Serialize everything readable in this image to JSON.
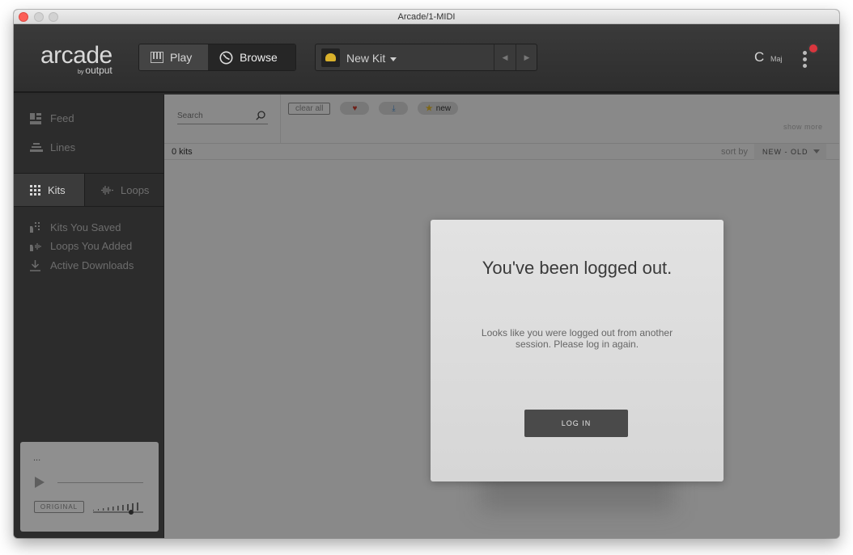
{
  "window": {
    "title": "Arcade/1-MIDI"
  },
  "header": {
    "logo": "arcade",
    "logo_by": "by",
    "logo_sub": "output",
    "mode_play": "Play",
    "mode_browse": "Browse",
    "kit_name": "New Kit",
    "key_root": "C",
    "key_mode": "Maj"
  },
  "sidebar": {
    "feed": "Feed",
    "lines": "Lines",
    "tab_kits": "Kits",
    "tab_loops": "Loops",
    "saved": "Kits You Saved",
    "added": "Loops You Added",
    "downloads": "Active Downloads"
  },
  "player": {
    "title": "...",
    "original_label": "ORIGINAL"
  },
  "main": {
    "search_placeholder": "Search",
    "clear_all": "clear all",
    "filter_new": "new",
    "show_more": "show more",
    "kits_count": "0 kits",
    "sort_label": "sort by",
    "sort_value": "NEW - OLD",
    "empty_fragment": "rch"
  },
  "modal": {
    "title": "You've been logged out.",
    "message": "Looks like you were logged out from another session. Please log in again.",
    "button": "LOG IN"
  },
  "colors": {
    "accent_gold": "#d9b12b",
    "notification_red": "#d9363e",
    "heart_red": "#c0392b",
    "download_blue": "#4a8cc9"
  }
}
